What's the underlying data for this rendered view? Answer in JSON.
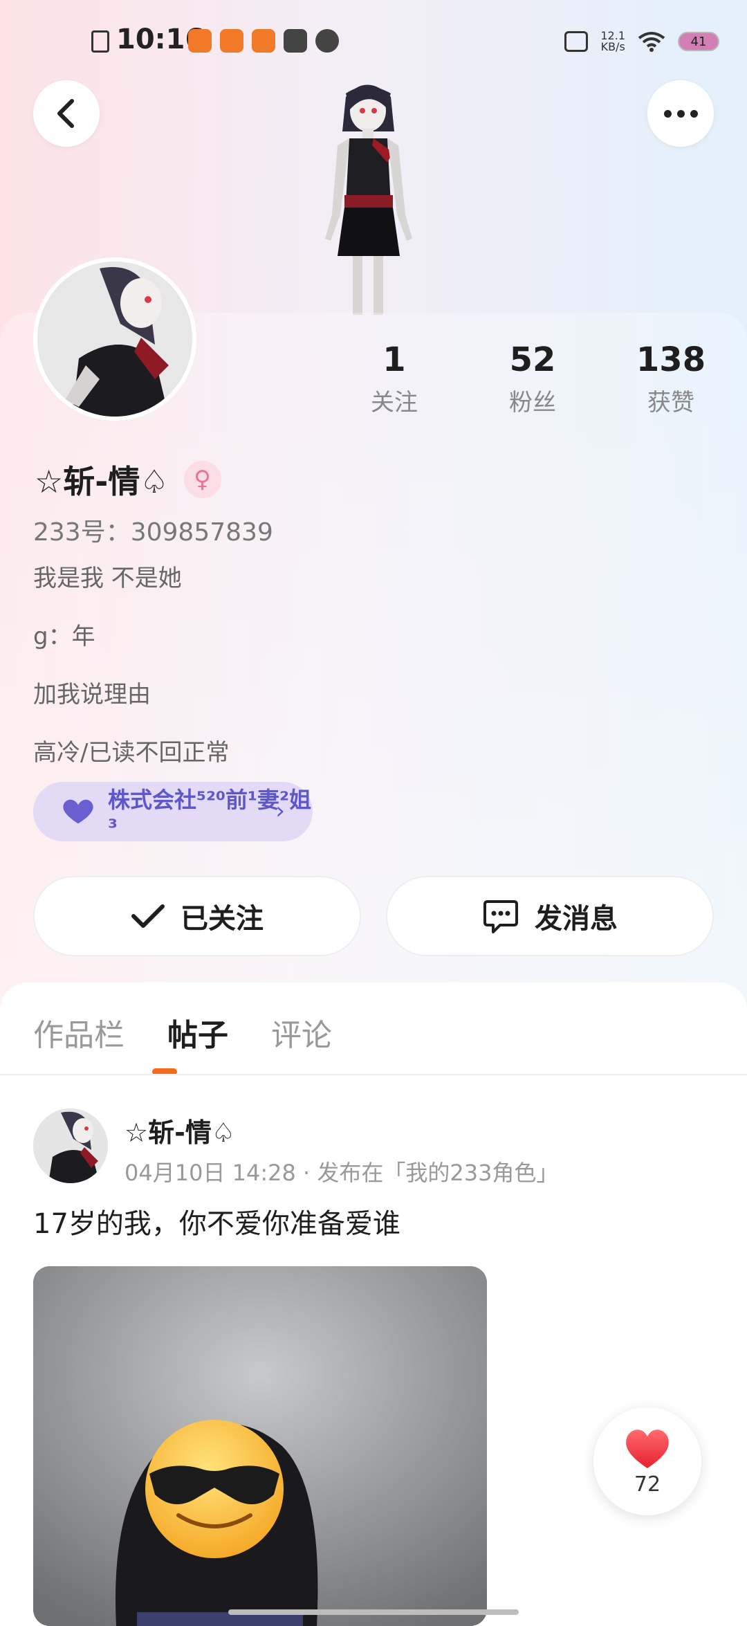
{
  "status_bar": {
    "time": "10:16",
    "net_speed_value": "12.1",
    "net_speed_unit": "KB/s",
    "battery": "41"
  },
  "profile": {
    "name": "☆斩-情♤",
    "uid": "233号：309857839",
    "bio": [
      "我是我 不是她",
      "g：年",
      "加我说理由",
      "高冷/已读不回正常"
    ],
    "stats": [
      {
        "value": "1",
        "label": "关注"
      },
      {
        "value": "52",
        "label": "粉丝"
      },
      {
        "value": "138",
        "label": "获赞"
      }
    ],
    "tag": "株式会社⁵²⁰前¹妻²姐³",
    "follow_button": "已关注",
    "message_button": "发消息"
  },
  "tabs": [
    {
      "label": "作品栏",
      "active": false
    },
    {
      "label": "帖子",
      "active": true
    },
    {
      "label": "评论",
      "active": false
    }
  ],
  "post": {
    "author": "☆斩-情♤",
    "meta": "04月10日 14:28 · 发布在「我的233角色」",
    "text": "17岁的我，你不爱你准备爱谁",
    "likes": "72"
  },
  "colors": {
    "accent": "#f56a1a",
    "tag_text": "#5d57c7",
    "tag_bg": "#e3daf6",
    "heart": "#f0434d"
  }
}
